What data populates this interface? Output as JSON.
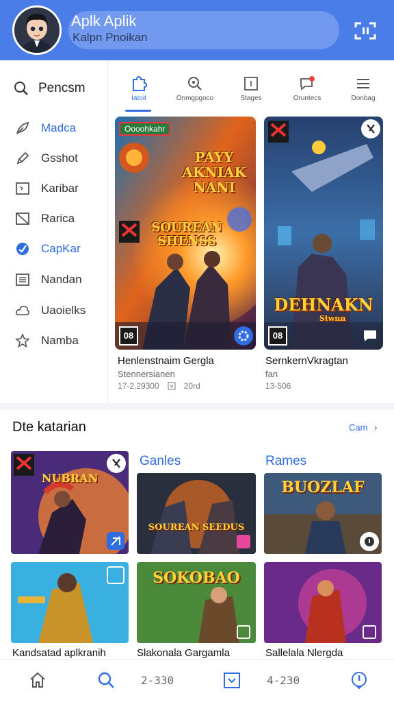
{
  "header": {
    "title": "Aplk Aplik",
    "subtitle": "Kalpn Pnoikan",
    "scan_icon": "scan-icon"
  },
  "sidebar": {
    "search_label": "Pencsm",
    "items": [
      {
        "label": "Madca",
        "icon": "feather-icon",
        "active": true
      },
      {
        "label": "Gsshot",
        "icon": "pencil-icon",
        "active": false
      },
      {
        "label": "Karibar",
        "icon": "frame-icon",
        "active": false
      },
      {
        "label": "Rarica",
        "icon": "crop-icon",
        "active": false
      },
      {
        "label": "CapKar",
        "icon": "check-badge-icon",
        "active": true
      },
      {
        "label": "Nandan",
        "icon": "list-icon",
        "active": false
      },
      {
        "label": "Uaoielks",
        "icon": "cloud-icon",
        "active": false
      },
      {
        "label": "Namba",
        "icon": "star-icon",
        "active": false
      }
    ]
  },
  "tabs": [
    {
      "label": "Iatoit",
      "icon": "puzzle-icon",
      "active": true
    },
    {
      "label": "Onmgpgoco",
      "icon": "search-tag-icon",
      "active": false
    },
    {
      "label": "Stages",
      "icon": "board-icon",
      "active": false
    },
    {
      "label": "Oruntecs",
      "icon": "chat-icon",
      "active": false
    },
    {
      "label": "Donbag",
      "icon": "menu-icon",
      "active": false
    }
  ],
  "featured": [
    {
      "badge": "Oooohkahr",
      "art_title": "PAYY AKNIAK NANI",
      "art_sub": "SOUREAN SHENSS",
      "rating": "08",
      "name": "Henlenstnaim Gergla",
      "category": "Stennersianen",
      "downloads": "17-2,29300",
      "size": "20rd"
    },
    {
      "art_title": "DEHNAKN",
      "art_sub": "Stwnn",
      "rating": "08",
      "name": "SernkernVkragtan",
      "category": "fan",
      "downloads": "13-506"
    }
  ],
  "section": {
    "title": "Dte katarian",
    "see_all": "Cam",
    "col_labels": [
      "Ganles",
      "Rames"
    ],
    "tiles": [
      {
        "art": "NUBRAN",
        "caption": ""
      },
      {
        "art": "SOUREAN SEEDUS",
        "caption": ""
      },
      {
        "art": "BUOZLAF",
        "caption": ""
      },
      {
        "art": "",
        "caption": "Kandsatad aplkranih"
      },
      {
        "art": "SOKOBAO",
        "caption": "Slakonala Gargamla"
      },
      {
        "art": "",
        "caption": "Sallelala Nlergda"
      }
    ]
  },
  "bottom_nav": {
    "items": [
      {
        "icon": "home-icon"
      },
      {
        "icon": "search-icon"
      },
      {
        "text": "2-330"
      },
      {
        "icon": "calendar-icon"
      },
      {
        "text": "4-230"
      },
      {
        "icon": "info-icon"
      }
    ]
  },
  "colors": {
    "header": "#4a7de8",
    "accent": "#2f6de0"
  }
}
